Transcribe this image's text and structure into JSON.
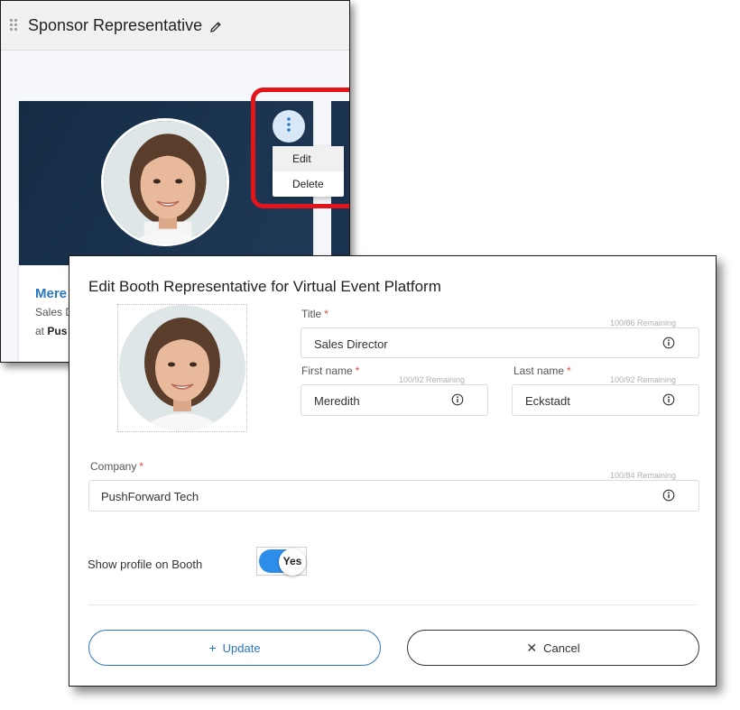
{
  "back_panel": {
    "title": "Sponsor Representative",
    "card": {
      "name_partial": "Mere",
      "subtitle_partial": "Sales D",
      "company_prefix": "at",
      "company_partial": "Pus"
    },
    "menu": {
      "items": [
        "Edit",
        "Delete"
      ]
    }
  },
  "modal": {
    "title": "Edit Booth Representative for Virtual Event Platform",
    "fields": {
      "title": {
        "label": "Title",
        "required": "*",
        "remaining": "100/86 Remaining",
        "value": "Sales Director"
      },
      "first_name": {
        "label": "First name",
        "required": "*",
        "remaining": "100/92 Remaining",
        "value": "Meredith"
      },
      "last_name": {
        "label": "Last name",
        "required": "*",
        "remaining": "100/92 Remaining",
        "value": "Eckstadt"
      },
      "company": {
        "label": "Company",
        "required": "*",
        "remaining": "100/84 Remaining",
        "value": "PushForward Tech"
      }
    },
    "toggle": {
      "label": "Show profile on Booth",
      "state": "Yes"
    },
    "buttons": {
      "update": {
        "icon": "+",
        "label": "Update"
      },
      "cancel": {
        "icon": "✕",
        "label": "Cancel"
      }
    }
  },
  "colors": {
    "accent": "#2b78c2",
    "highlight": "#e3151b",
    "toggle_on": "#2d8ee9",
    "banner": "#142b44",
    "required": "#e04848"
  },
  "icons": [
    "drag-handle-icon",
    "pencil-icon",
    "kebab-icon",
    "info-icon",
    "plus-icon",
    "close-icon"
  ]
}
